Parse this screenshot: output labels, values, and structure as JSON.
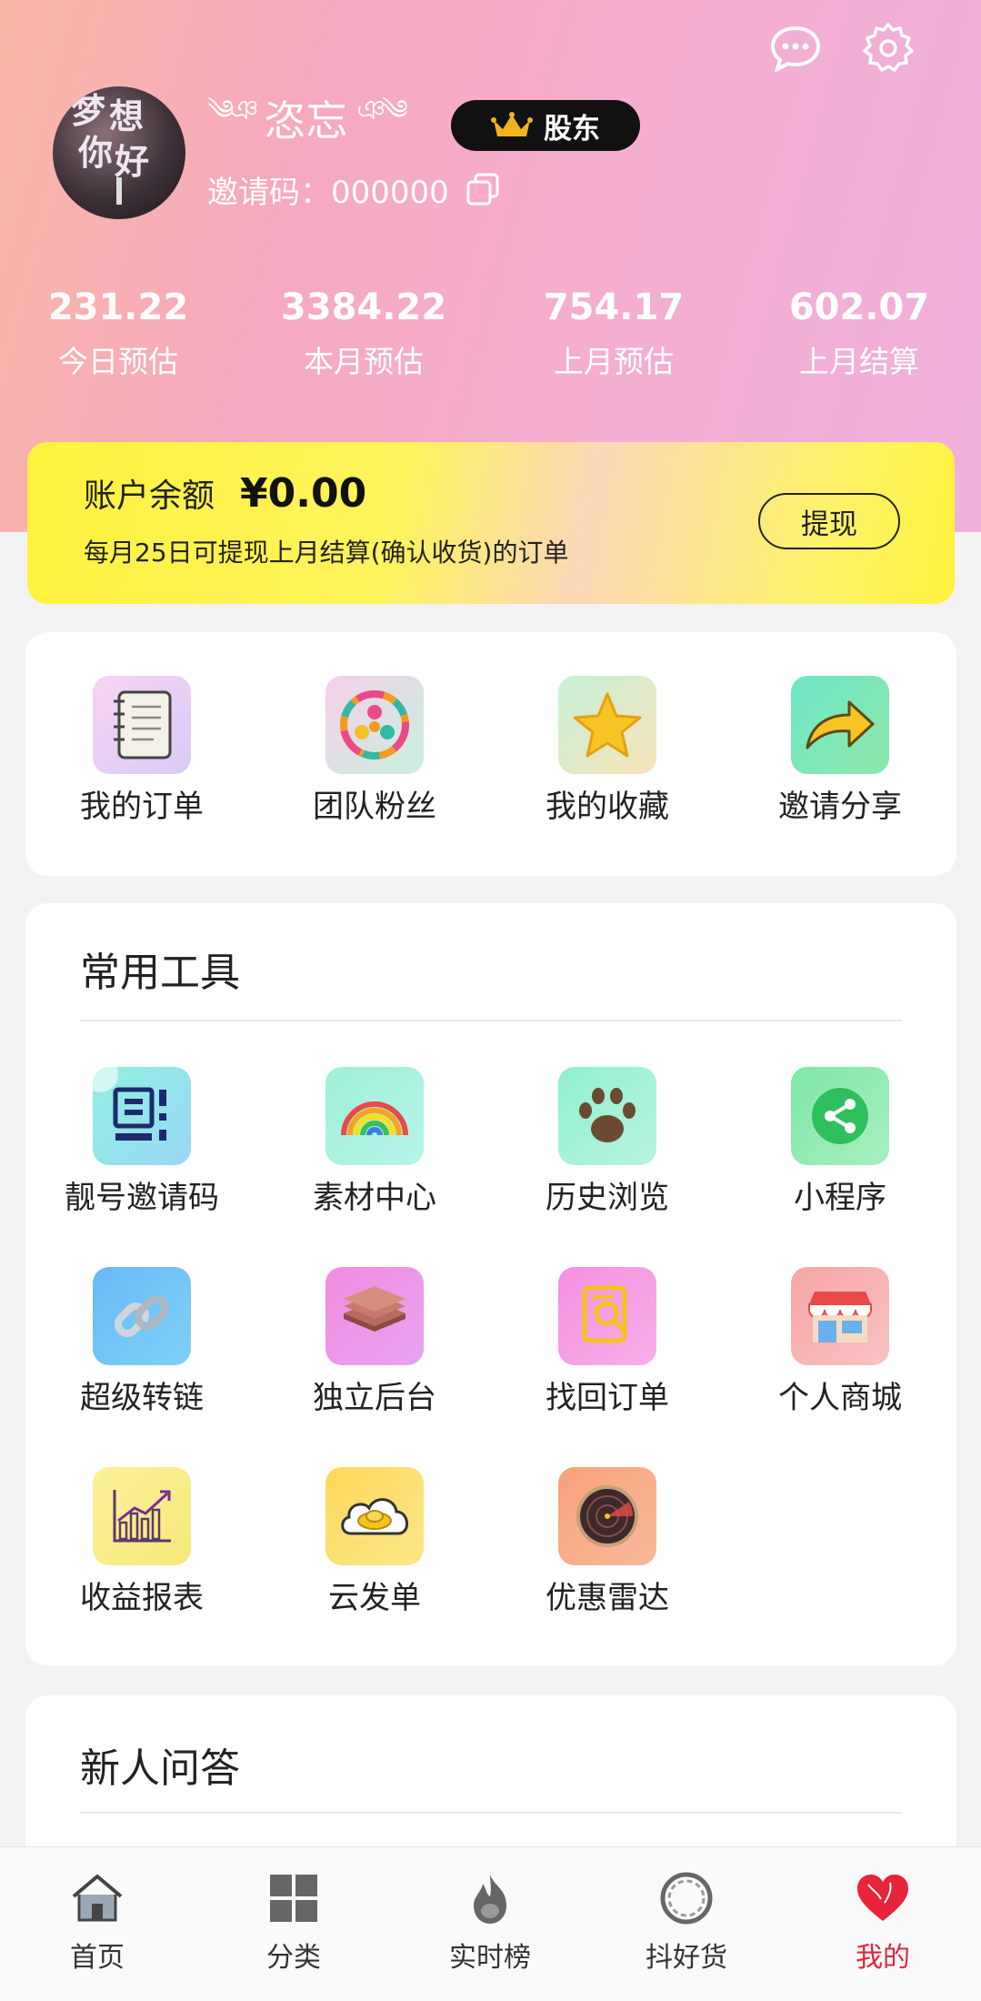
{
  "header": {
    "username": "恣忘",
    "badge": "股东",
    "invite_code": "邀请码：000000",
    "avatar_text": [
      "梦",
      "想",
      "你",
      "好"
    ],
    "icons": [
      "chat-icon",
      "gear-icon"
    ]
  },
  "stats": [
    {
      "value": "231.22",
      "label": "今日预估"
    },
    {
      "value": "3384.22",
      "label": "本月预估"
    },
    {
      "value": "754.17",
      "label": "上月预估"
    },
    {
      "value": "602.07",
      "label": "上月结算"
    }
  ],
  "balance": {
    "label": "账户余额",
    "amount": "¥0.00",
    "note": "每月25日可提现上月结算(确认收货)的订单",
    "withdraw_label": "提现"
  },
  "quick_actions": [
    {
      "label": "我的订单",
      "icon": "notebook-icon"
    },
    {
      "label": "团队粉丝",
      "icon": "team-icon"
    },
    {
      "label": "我的收藏",
      "icon": "star-icon"
    },
    {
      "label": "邀请分享",
      "icon": "share-arrow-icon"
    }
  ],
  "tools": {
    "title": "常用工具",
    "items": [
      {
        "label": "靓号邀请码",
        "icon": "qrcode-icon"
      },
      {
        "label": "素材中心",
        "icon": "rainbow-icon"
      },
      {
        "label": "历史浏览",
        "icon": "paw-icon"
      },
      {
        "label": "小程序",
        "icon": "share-icon"
      },
      {
        "label": "超级转链",
        "icon": "link-icon"
      },
      {
        "label": "独立后台",
        "icon": "layers-icon"
      },
      {
        "label": "找回订单",
        "icon": "search-doc-icon"
      },
      {
        "label": "个人商城",
        "icon": "store-icon"
      },
      {
        "label": "收益报表",
        "icon": "chart-icon"
      },
      {
        "label": "云发单",
        "icon": "cloud-ingot-icon"
      },
      {
        "label": "优惠雷达",
        "icon": "radar-icon"
      }
    ]
  },
  "faq": {
    "title": "新人问答"
  },
  "tabbar": [
    {
      "label": "首页",
      "icon": "home-icon",
      "active": false
    },
    {
      "label": "分类",
      "icon": "category-icon",
      "active": false
    },
    {
      "label": "实时榜",
      "icon": "fire-icon",
      "active": false
    },
    {
      "label": "抖好货",
      "icon": "ring-icon",
      "active": false
    },
    {
      "label": "我的",
      "icon": "heart-icon",
      "active": true
    }
  ],
  "colors": {
    "accent": "#e8243b",
    "header_from": "#f9b8a5",
    "header_to": "#efb0dd",
    "balance_yellow": "#fff23d"
  }
}
